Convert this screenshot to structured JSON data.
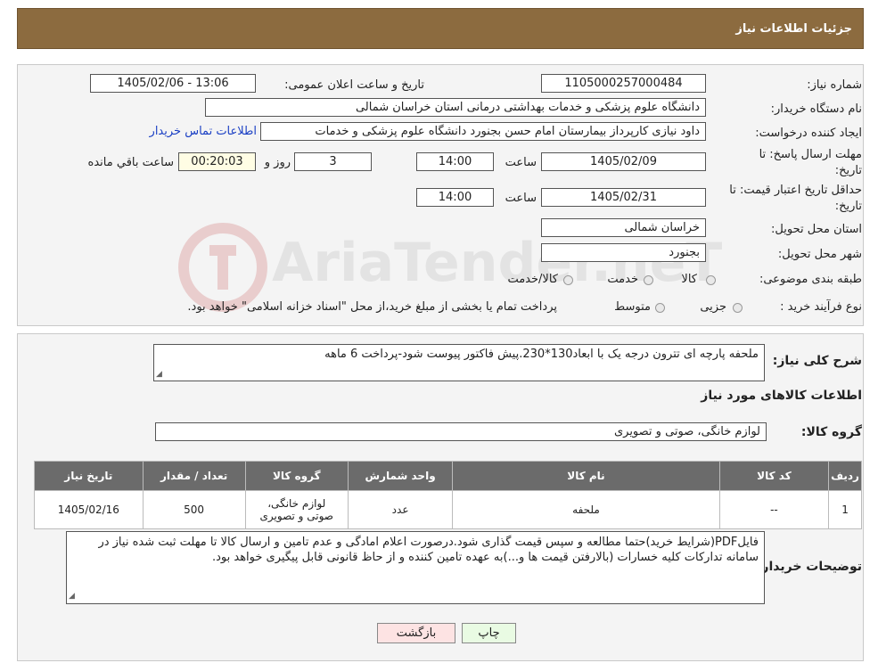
{
  "header": {
    "title": "جزئیات اطلاعات نیاز"
  },
  "form": {
    "need_number_label": "شماره نیاز:",
    "need_number": "1105000257000484",
    "announce_label": "تاریخ و ساعت اعلان عمومی:",
    "announce_value": "1405/02/06 - 13:06",
    "buyer_org_label": "نام دستگاه خریدار:",
    "buyer_org": "دانشگاه علوم پزشکی و خدمات بهداشتی درمانی استان خراسان شمالی",
    "creator_label": "ایجاد کننده درخواست:",
    "creator": "داود نیازی کارپرداز بیمارستان امام حسن بجنورد دانشگاه علوم پزشکی و خدمات",
    "contact_link": "اطلاعات تماس خریدار",
    "deadline_label_1": "مهلت ارسال پاسخ: تا",
    "deadline_label_2": "تاریخ:",
    "deadline_date": "1405/02/09",
    "time_label": "ساعت",
    "deadline_time": "14:00",
    "days_value": "3",
    "days_label": "روز و",
    "remaining_time": "00:20:03",
    "remaining_label": "ساعت باقي مانده",
    "validity_label_1": "حداقل تاریخ اعتبار قیمت: تا",
    "validity_label_2": "تاریخ:",
    "validity_date": "1405/02/31",
    "validity_time": "14:00",
    "province_label": "استان محل تحویل:",
    "province": "خراسان شمالی",
    "city_label": "شهر محل تحویل:",
    "city": "بجنورد",
    "category_label": "طبقه بندی موضوعی:",
    "category_options": [
      "کالا",
      "خدمت",
      "کالا/خدمت"
    ],
    "process_label": "نوع فرآیند خرید :",
    "process_options": [
      "جزیی",
      "متوسط"
    ],
    "process_note": "پرداخت تمام یا بخشی از مبلغ خرید،از محل \"اسناد خزانه اسلامی\" خواهد بود."
  },
  "description": {
    "label": "شرح کلی نیاز:",
    "text": "ملحفه پارچه ای تترون درجه یک با ابعاد130*230.پیش فاکتور پیوست  شود-پرداخت 6 ماهه"
  },
  "goods": {
    "section_title": "اطلاعات کالاهای مورد نیاز",
    "group_label": "گروه کالا:",
    "group_value": "لوازم خانگی، صوتی و تصویری",
    "columns": [
      "ردیف",
      "کد کالا",
      "نام کالا",
      "واحد شمارش",
      "گروه کالا",
      "تعداد / مقدار",
      "تاریخ نیاز"
    ],
    "rows": [
      [
        "1",
        "--",
        "ملحفه",
        "عدد",
        "لوازم خانگی، صوتی و تصویری",
        "500",
        "1405/02/16"
      ]
    ]
  },
  "buyer_notes": {
    "label": "توضیحات خریدار:",
    "text": "فایلPDF(شرایط خرید)حتما مطالعه و سپس قیمت گذاری شود.درصورت اعلام امادگی و عدم تامین و ارسال کالا تا مهلت ثبت شده نیاز در سامانه تدارکات کلیه خسارات (بالارفتن قیمت ها و...)به عهده تامین کننده و از حاظ قانونی قابل پیگیری خواهد بود."
  },
  "buttons": {
    "print": "چاپ",
    "back": "بازگشت"
  },
  "watermark": {
    "text": "AriaTender.neT"
  },
  "colors": {
    "header_bg": "#8c6b3f",
    "table_header_bg": "#6b6b6b",
    "link": "#1a3fc4",
    "back_button_bg": "#fde3e3",
    "print_button_bg": "#e9fbe3"
  }
}
